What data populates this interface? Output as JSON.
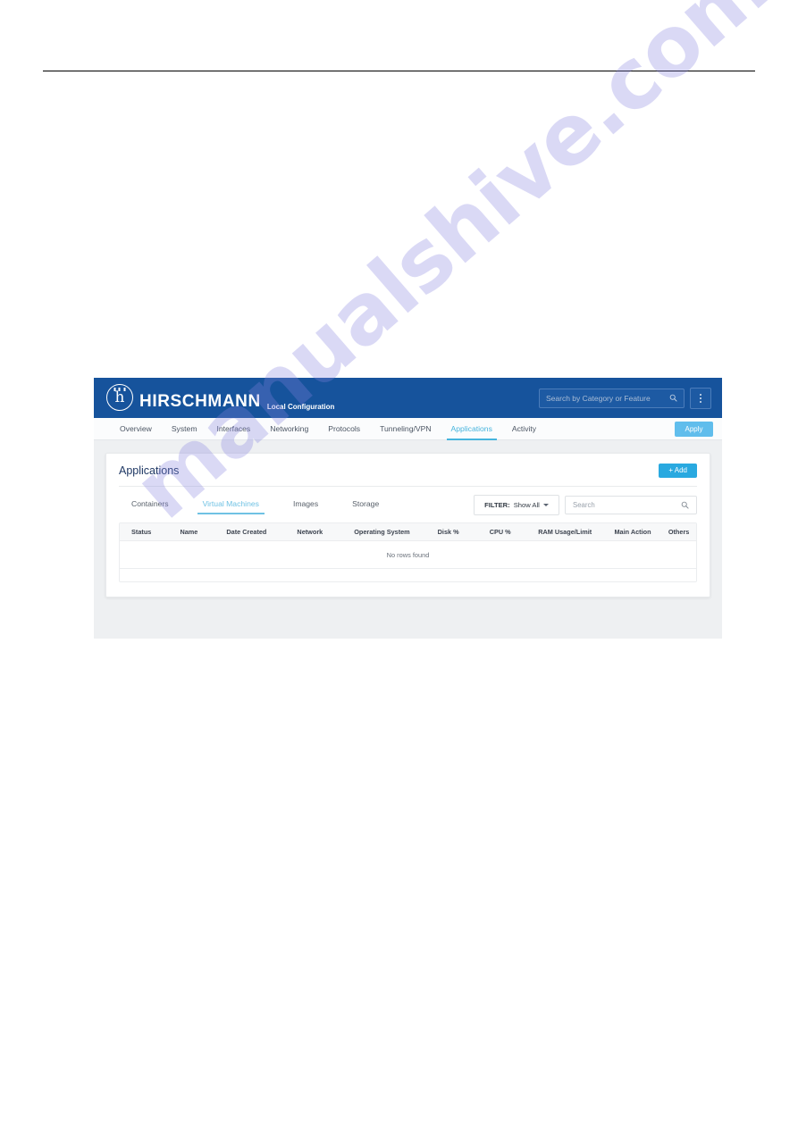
{
  "app": {
    "brand_name": "HIRSCHMANN",
    "brand_subtitle": "Local Configuration",
    "logo_icon": "hirschmann-h-crest-icon",
    "header_search_placeholder": "Search by Category or Feature",
    "header_search_value": "",
    "header_search_icon": "search-icon",
    "overflow_icon": "kebab-menu-icon"
  },
  "nav": {
    "items": [
      {
        "label": "Overview",
        "active": false
      },
      {
        "label": "System",
        "active": false
      },
      {
        "label": "Interfaces",
        "active": false
      },
      {
        "label": "Networking",
        "active": false
      },
      {
        "label": "Protocols",
        "active": false
      },
      {
        "label": "Tunneling/VPN",
        "active": false
      },
      {
        "label": "Applications",
        "active": true
      },
      {
        "label": "Activity",
        "active": false
      }
    ],
    "apply_label": "Apply"
  },
  "panel": {
    "title": "Applications",
    "add_label": "+ Add",
    "sub_tabs": [
      {
        "label": "Containers",
        "active": false
      },
      {
        "label": "Virtual Machines",
        "active": true
      },
      {
        "label": "Images",
        "active": false
      },
      {
        "label": "Storage",
        "active": false
      }
    ],
    "filter": {
      "prefix": "FILTER:",
      "value": "Show All",
      "caret_icon": "chevron-down-icon"
    },
    "search": {
      "placeholder": "Search",
      "value": "",
      "icon": "search-icon"
    },
    "table": {
      "columns": [
        "Status",
        "Name",
        "Date Created",
        "Network",
        "Operating System",
        "Disk %",
        "CPU %",
        "RAM Usage/Limit",
        "Main Action",
        "Others"
      ],
      "rows": [],
      "empty_message": "No rows found"
    }
  },
  "watermark": {
    "text": "manualshive.com"
  },
  "colors": {
    "header_blue": "#16539c",
    "accent_cyan": "#46b4dd",
    "add_button_blue": "#29a9e0",
    "apply_button_blue": "#45b3ea",
    "title_navy": "#1f3864",
    "page_bg": "#eef0f2",
    "watermark": "#8680de"
  }
}
